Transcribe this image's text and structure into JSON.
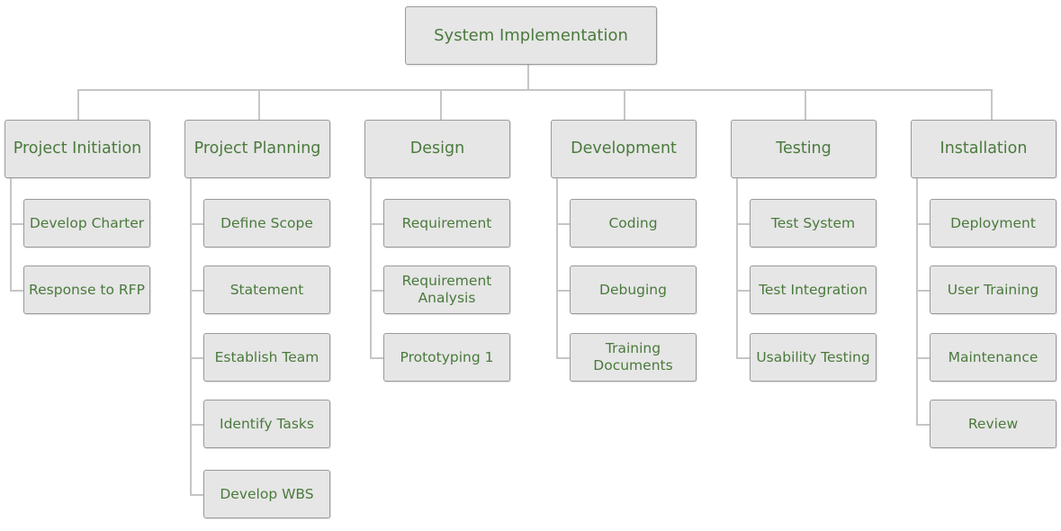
{
  "diagram": {
    "type": "work-breakdown-structure",
    "root": {
      "label": "System Implementation"
    },
    "colors": {
      "text": "#4a7a3c",
      "node_fill": "#e6e6e6",
      "node_border": "#9a9a9a",
      "connector": "#c6c6c6"
    },
    "phases": [
      {
        "label": "Project Initiation",
        "tasks": [
          "Develop Charter",
          "Response to RFP"
        ]
      },
      {
        "label": "Project Planning",
        "tasks": [
          "Define Scope",
          "Statement",
          "Establish Team",
          "Identify Tasks",
          "Develop WBS"
        ]
      },
      {
        "label": "Design",
        "tasks": [
          "Requirement",
          "Requirement Analysis",
          "Prototyping 1"
        ]
      },
      {
        "label": "Development",
        "tasks": [
          "Coding",
          "Debuging",
          "Training Documents"
        ]
      },
      {
        "label": "Testing",
        "tasks": [
          "Test System",
          "Test Integration",
          "Usability Testing"
        ]
      },
      {
        "label": "Installation",
        "tasks": [
          "Deployment",
          "User Training",
          "Maintenance",
          "Review"
        ]
      }
    ]
  }
}
